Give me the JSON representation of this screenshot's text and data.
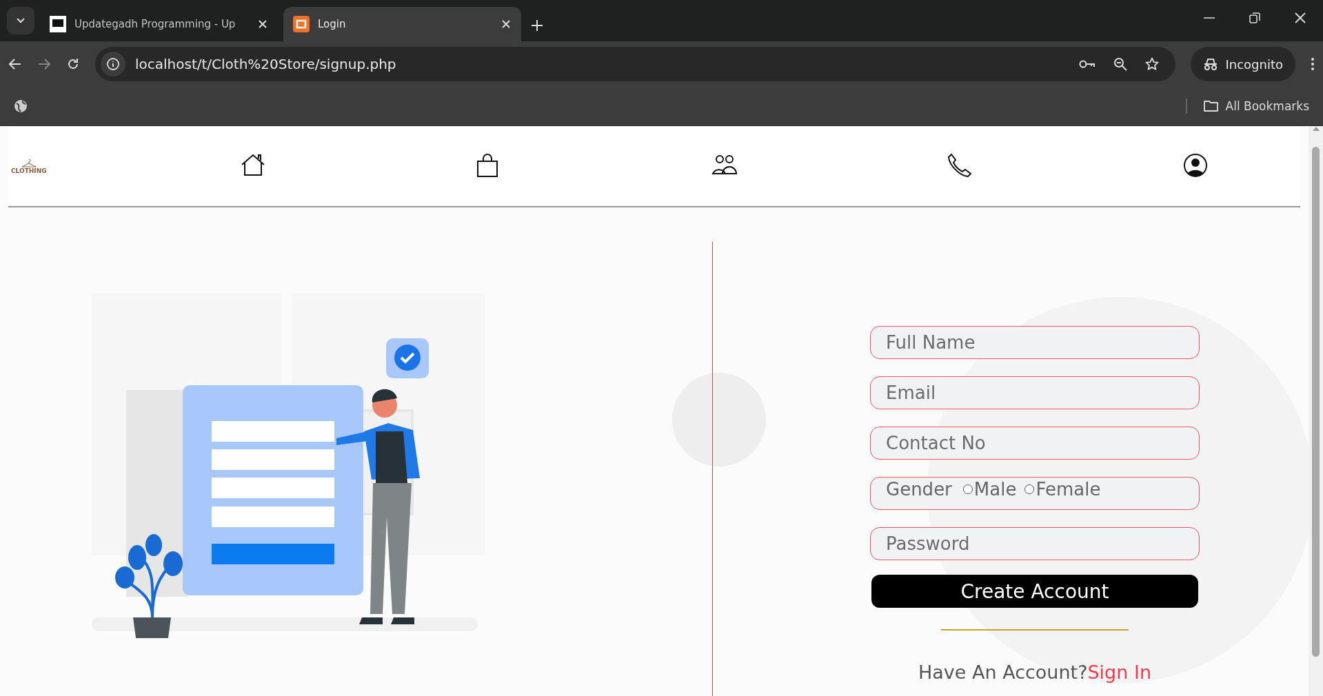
{
  "browser": {
    "tabs": [
      {
        "title": "Updategadh Programming - Up",
        "selected": false
      },
      {
        "title": "Login",
        "selected": true
      }
    ],
    "address": "localhost/t/Cloth%20Store/signup.php",
    "profile": "Incognito",
    "bookmarks": "All Bookmarks"
  },
  "site": {
    "logo": "CLOTHING"
  },
  "form": {
    "fields": [
      {
        "kind": "text",
        "placeholder": "Full Name"
      },
      {
        "kind": "text",
        "placeholder": "Email"
      },
      {
        "kind": "text",
        "placeholder": "Contact No"
      },
      {
        "kind": "radio",
        "label": "Gender",
        "options": [
          {
            "label": "Male",
            "selected": false
          },
          {
            "label": "Female",
            "selected": false
          }
        ]
      },
      {
        "kind": "password",
        "placeholder": "Password"
      }
    ],
    "submit": "Create Account",
    "prompt": "Have An Account?",
    "link": "Sign In"
  }
}
